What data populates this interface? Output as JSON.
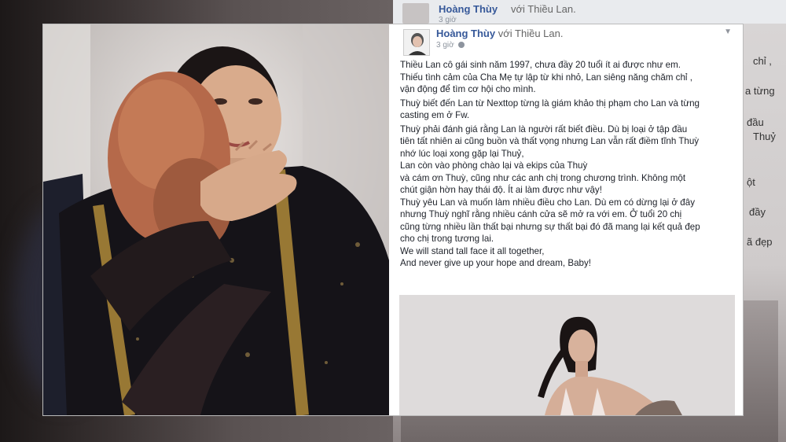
{
  "background_post": {
    "author": "Hoàng Thùy",
    "with_text": "với Thiều Lan.",
    "time": "3 giờ",
    "snippets": [
      "chỉ ,",
      "a từng",
      "đầu",
      "Thuỷ",
      "ột",
      "đầy",
      "ã đẹp"
    ]
  },
  "post": {
    "author": "Hoàng Thùy",
    "with_text": "với Thiều Lan.",
    "time": "3 giờ",
    "lines": [
      "Thiều Lan cô gái sinh năm 1997, chưa đầy 20 tuổi ít ai được như em.",
      "Thiếu tình cảm của Cha Mẹ tự lập từ khi nhỏ, Lan siêng năng chăm chỉ ,",
      "vận động để tìm cơ hội cho mình.",
      "Thuỳ biết đến Lan từ Nexttop từng là giám khảo thị phạm cho Lan và từng",
      "casting em ở Fw.",
      "Thuỳ phải đánh giá rằng Lan là người rất biết điều. Dù bị loại ở tập đầu",
      "tiên tất nhiên ai cũng buồn và thất vọng nhưng Lan vẫn rất điềm tĩnh Thuỳ",
      "nhớ lúc loại xong gặp lại Thuỷ,",
      "Lan còn vào phòng chào lại và ekips của Thuỳ",
      "và cám ơn Thuỳ, cũng như các anh chị trong chương trình. Không một",
      "chút giận hờn hay thái độ. Ít ai làm được như vậy!",
      "Thuỳ yêu Lan và muốn làm nhiều điều cho Lan. Dù em có dừng lại ở đây",
      "nhưng Thuỳ nghĩ rằng nhiều cánh cửa sẽ mở ra với em. Ở tuổi 20 chị",
      "cũng từng nhiều lần thất bại nhưng sự thất bại đó đã mang lại kết quả đẹp",
      "cho chị trong tương lai.",
      "We will stand tall face it all together,",
      "And never give up your hope and dream, Baby!"
    ]
  },
  "colors": {
    "link": "#365899",
    "text": "#1d2129",
    "meta": "#8d949e"
  }
}
